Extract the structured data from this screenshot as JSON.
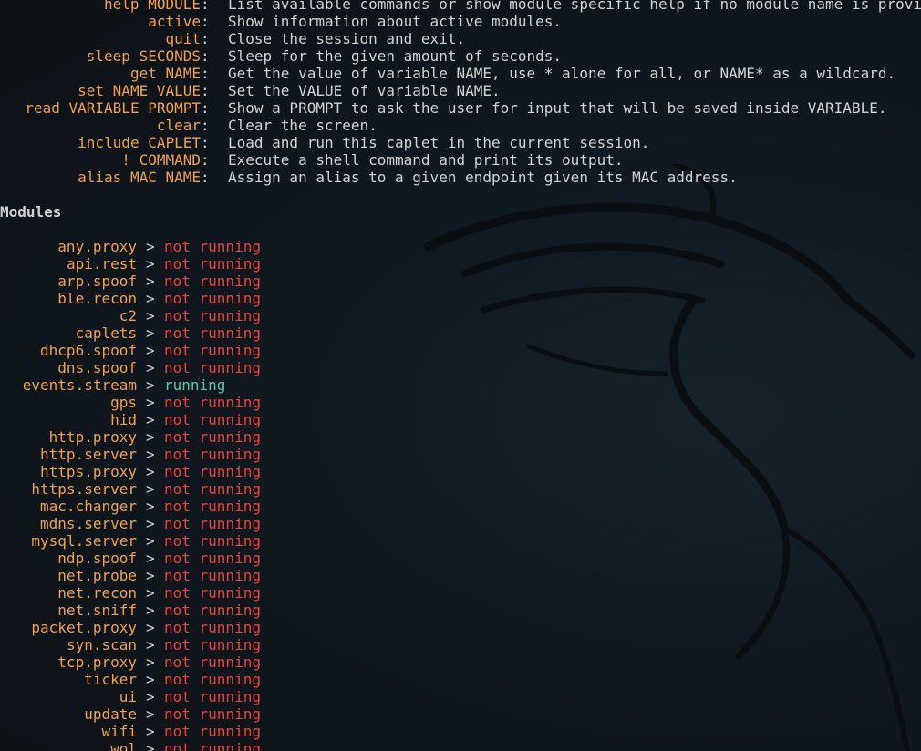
{
  "commands": [
    {
      "cmd": "help MODULE",
      "desc": "List available commands or show module specific help if no module name is provided."
    },
    {
      "cmd": "active",
      "desc": "Show information about active modules."
    },
    {
      "cmd": "quit",
      "desc": "Close the session and exit."
    },
    {
      "cmd": "sleep SECONDS",
      "desc": "Sleep for the given amount of seconds."
    },
    {
      "cmd": "get NAME",
      "desc": "Get the value of variable NAME, use * alone for all, or NAME* as a wildcard."
    },
    {
      "cmd": "set NAME VALUE",
      "desc": "Set the VALUE of variable NAME."
    },
    {
      "cmd": "read VARIABLE PROMPT",
      "desc": "Show a PROMPT to ask the user for input that will be saved inside VARIABLE."
    },
    {
      "cmd": "clear",
      "desc": "Clear the screen."
    },
    {
      "cmd": "include CAPLET",
      "desc": "Load and run this caplet in the current session."
    },
    {
      "cmd": "! COMMAND",
      "desc": "Execute a shell command and print its output."
    },
    {
      "cmd": "alias MAC NAME",
      "desc": "Assign an alias to a given endpoint given its MAC address."
    }
  ],
  "modules_heading": "Modules",
  "separator_colon": ":",
  "separator_arrow": ">",
  "modules": [
    {
      "name": "any.proxy",
      "status": "not running",
      "running": false
    },
    {
      "name": "api.rest",
      "status": "not running",
      "running": false
    },
    {
      "name": "arp.spoof",
      "status": "not running",
      "running": false
    },
    {
      "name": "ble.recon",
      "status": "not running",
      "running": false
    },
    {
      "name": "c2",
      "status": "not running",
      "running": false
    },
    {
      "name": "caplets",
      "status": "not running",
      "running": false
    },
    {
      "name": "dhcp6.spoof",
      "status": "not running",
      "running": false
    },
    {
      "name": "dns.spoof",
      "status": "not running",
      "running": false
    },
    {
      "name": "events.stream",
      "status": "running",
      "running": true
    },
    {
      "name": "gps",
      "status": "not running",
      "running": false
    },
    {
      "name": "hid",
      "status": "not running",
      "running": false
    },
    {
      "name": "http.proxy",
      "status": "not running",
      "running": false
    },
    {
      "name": "http.server",
      "status": "not running",
      "running": false
    },
    {
      "name": "https.proxy",
      "status": "not running",
      "running": false
    },
    {
      "name": "https.server",
      "status": "not running",
      "running": false
    },
    {
      "name": "mac.changer",
      "status": "not running",
      "running": false
    },
    {
      "name": "mdns.server",
      "status": "not running",
      "running": false
    },
    {
      "name": "mysql.server",
      "status": "not running",
      "running": false
    },
    {
      "name": "ndp.spoof",
      "status": "not running",
      "running": false
    },
    {
      "name": "net.probe",
      "status": "not running",
      "running": false
    },
    {
      "name": "net.recon",
      "status": "not running",
      "running": false
    },
    {
      "name": "net.sniff",
      "status": "not running",
      "running": false
    },
    {
      "name": "packet.proxy",
      "status": "not running",
      "running": false
    },
    {
      "name": "syn.scan",
      "status": "not running",
      "running": false
    },
    {
      "name": "tcp.proxy",
      "status": "not running",
      "running": false
    },
    {
      "name": "ticker",
      "status": "not running",
      "running": false
    },
    {
      "name": "ui",
      "status": "not running",
      "running": false
    },
    {
      "name": "update",
      "status": "not running",
      "running": false
    },
    {
      "name": "wifi",
      "status": "not running",
      "running": false
    },
    {
      "name": "wol",
      "status": "not running",
      "running": false
    }
  ],
  "colors": {
    "command": "#f0a24f",
    "text": "#d3d3d3",
    "not_running": "#e8453c",
    "running": "#5cc9a7",
    "background": "#0f1418"
  },
  "background_icon": "kali-dragon-icon"
}
